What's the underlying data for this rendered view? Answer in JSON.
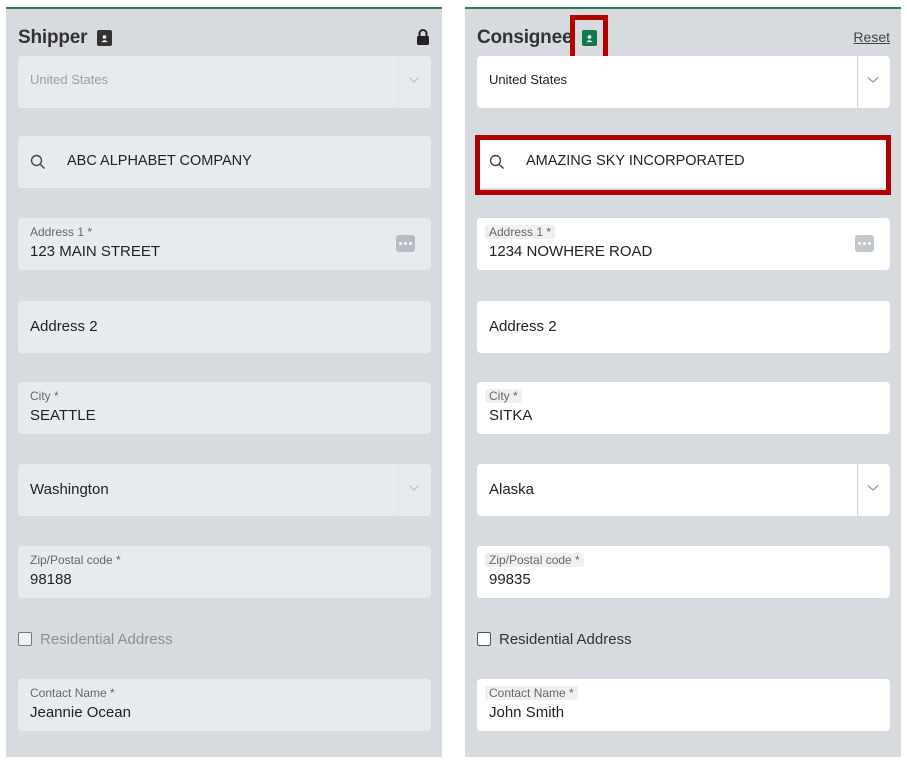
{
  "shipper": {
    "title": "Shipper",
    "country": "United States",
    "search_value": "ABC ALPHABET COMPANY",
    "address1_label": "Address 1 *",
    "address1": "123 MAIN STREET",
    "address2_placeholder": "Address 2",
    "city_label": "City *",
    "city": "SEATTLE",
    "state": "Washington",
    "zip_label": "Zip/Postal code *",
    "zip": "98188",
    "residential_label": "Residential Address",
    "contact_label": "Contact Name *",
    "contact": "Jeannie Ocean"
  },
  "consignee": {
    "title": "Consignee",
    "reset_label": "Reset",
    "country": "United States",
    "search_value": "AMAZING SKY INCORPORATED",
    "address1_label": "Address 1 *",
    "address1": "1234 NOWHERE ROAD",
    "address2_placeholder": "Address 2",
    "city_label": "City *",
    "city": "SITKA",
    "state": "Alaska",
    "zip_label": "Zip/Postal code *",
    "zip": "99835",
    "residential_label": "Residential Address",
    "contact_label": "Contact Name *",
    "contact": "John Smith"
  },
  "colors": {
    "panel_bg": "#d7dbe0",
    "accent_green": "#127a4a",
    "highlight_red": "#b00000"
  },
  "icons": [
    "contact-book-icon",
    "lock-icon",
    "search-icon",
    "chevron-down-icon",
    "more-dots-icon"
  ]
}
